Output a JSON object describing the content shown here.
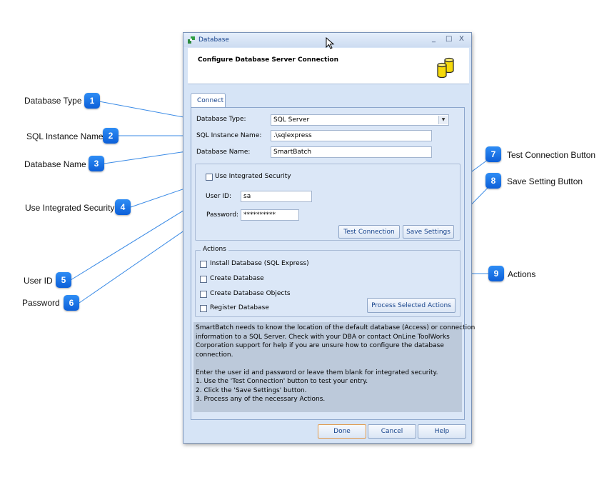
{
  "window": {
    "title": "Database",
    "header_title": "Configure Database Server Connection",
    "controls": {
      "minimize": "_",
      "maximize": "□",
      "close": "X"
    }
  },
  "tab": {
    "label": "Connect"
  },
  "form": {
    "database_type_label": "Database Type:",
    "database_type_value": "SQL Server",
    "sql_instance_label": "SQL Instance Name:",
    "sql_instance_value": ".\\sqlexpress",
    "database_name_label": "Database Name:",
    "database_name_value": "SmartBatch"
  },
  "auth": {
    "integrated_security_label": "Use Integrated Security",
    "integrated_security_checked": false,
    "user_id_label": "User ID:",
    "user_id_value": "sa",
    "password_label": "Password:",
    "password_value": "**********",
    "test_connection_label": "Test Connection",
    "save_settings_label": "Save Settings"
  },
  "actions": {
    "legend": "Actions",
    "items": [
      {
        "label": "Install Database (SQL Express)",
        "checked": false
      },
      {
        "label": "Create Database",
        "checked": false
      },
      {
        "label": "Create Database Objects",
        "checked": false
      },
      {
        "label": "Register Database",
        "checked": false
      }
    ],
    "process_label": "Process Selected Actions"
  },
  "info_lines": [
    "SmartBatch needs to know the location of the default database (Access) or connection",
    "information to a SQL Server. Check with your DBA or contact OnLine ToolWorks",
    "Corporation support for help if you are unsure how to configure the database",
    "connection.",
    "",
    "Enter the user id and password or leave them blank for integrated security.",
    "1.  Use the 'Test Connection' button to test your entry.",
    "2.  Click the 'Save Settings' button.",
    "3.  Process any of the necessary Actions."
  ],
  "footer": {
    "done_label": "Done",
    "cancel_label": "Cancel",
    "help_label": "Help"
  },
  "callouts": [
    {
      "number": "1",
      "label": "Database Type"
    },
    {
      "number": "2",
      "label": "SQL Instance Name"
    },
    {
      "number": "3",
      "label": "Database Name"
    },
    {
      "number": "4",
      "label": "Use Integrated Security"
    },
    {
      "number": "5",
      "label": "User ID"
    },
    {
      "number": "6",
      "label": "Password"
    },
    {
      "number": "7",
      "label": "Test Connection Button"
    },
    {
      "number": "8",
      "label": "Save Setting Button"
    },
    {
      "number": "9",
      "label": "Actions"
    }
  ],
  "colors": {
    "badge": "#1a73e8",
    "callout_line": "#3b8be6",
    "title_text": "#15428b"
  }
}
